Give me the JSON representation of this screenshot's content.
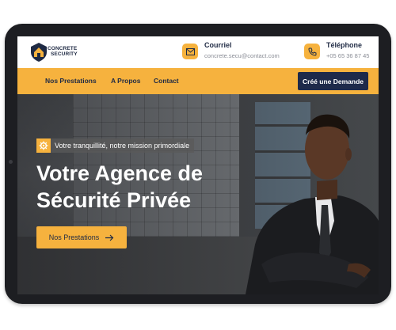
{
  "brand": {
    "line1": "CONCRETE",
    "line2": "SECURITY"
  },
  "contacts": [
    {
      "label": "Courriel",
      "value": "concrete.secu@contact.com",
      "icon": "mail-icon"
    },
    {
      "label": "Téléphone",
      "value": "+05 65 36 87 45",
      "icon": "phone-icon"
    }
  ],
  "nav": {
    "items": [
      "Nos Prestations",
      "A Propos",
      "Contact"
    ],
    "cta": "Créé une Demande"
  },
  "hero": {
    "tagline": "Votre tranquillité, notre mission primordiale",
    "title_line1": "Votre Agence de",
    "title_line2": "Sécurité Privée",
    "cta": "Nos Prestations"
  },
  "colors": {
    "accent": "#f6b23e",
    "navy": "#1e2a4a"
  }
}
